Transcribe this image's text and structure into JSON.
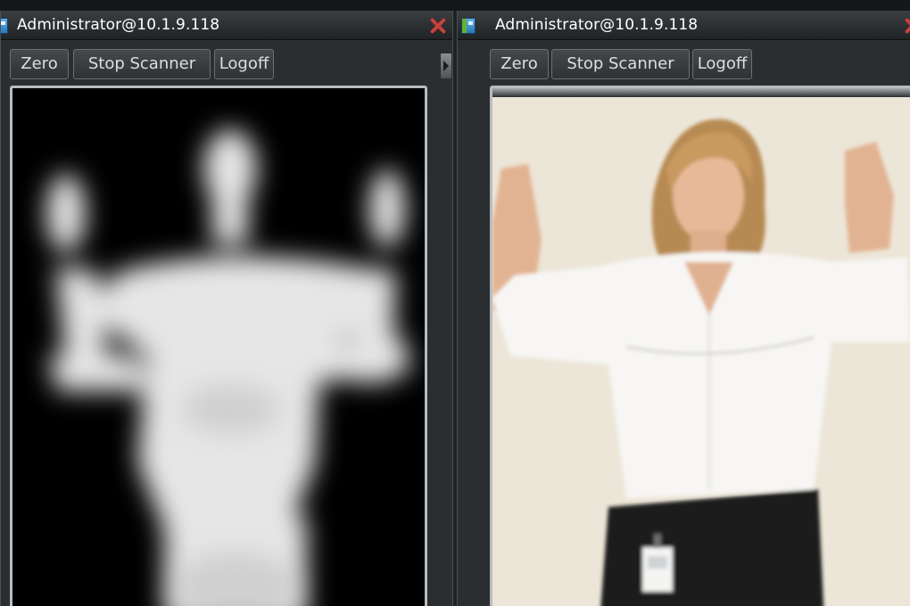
{
  "left_window": {
    "title": "Administrator@10.1.9.118",
    "buttons": {
      "zero": "Zero",
      "stop_scanner": "Stop Scanner",
      "logoff": "Logoff"
    },
    "icon": "close-icon"
  },
  "right_window": {
    "title": "Administrator@10.1.9.118",
    "buttons": {
      "zero": "Zero",
      "stop_scanner": "Stop Scanner",
      "logoff": "Logoff"
    },
    "icon": "close-icon"
  },
  "colors": {
    "window_bg": "#2b2e30",
    "titlebar_text": "#ffffff",
    "close_red": "#c8423e",
    "button_text": "#dedede"
  }
}
